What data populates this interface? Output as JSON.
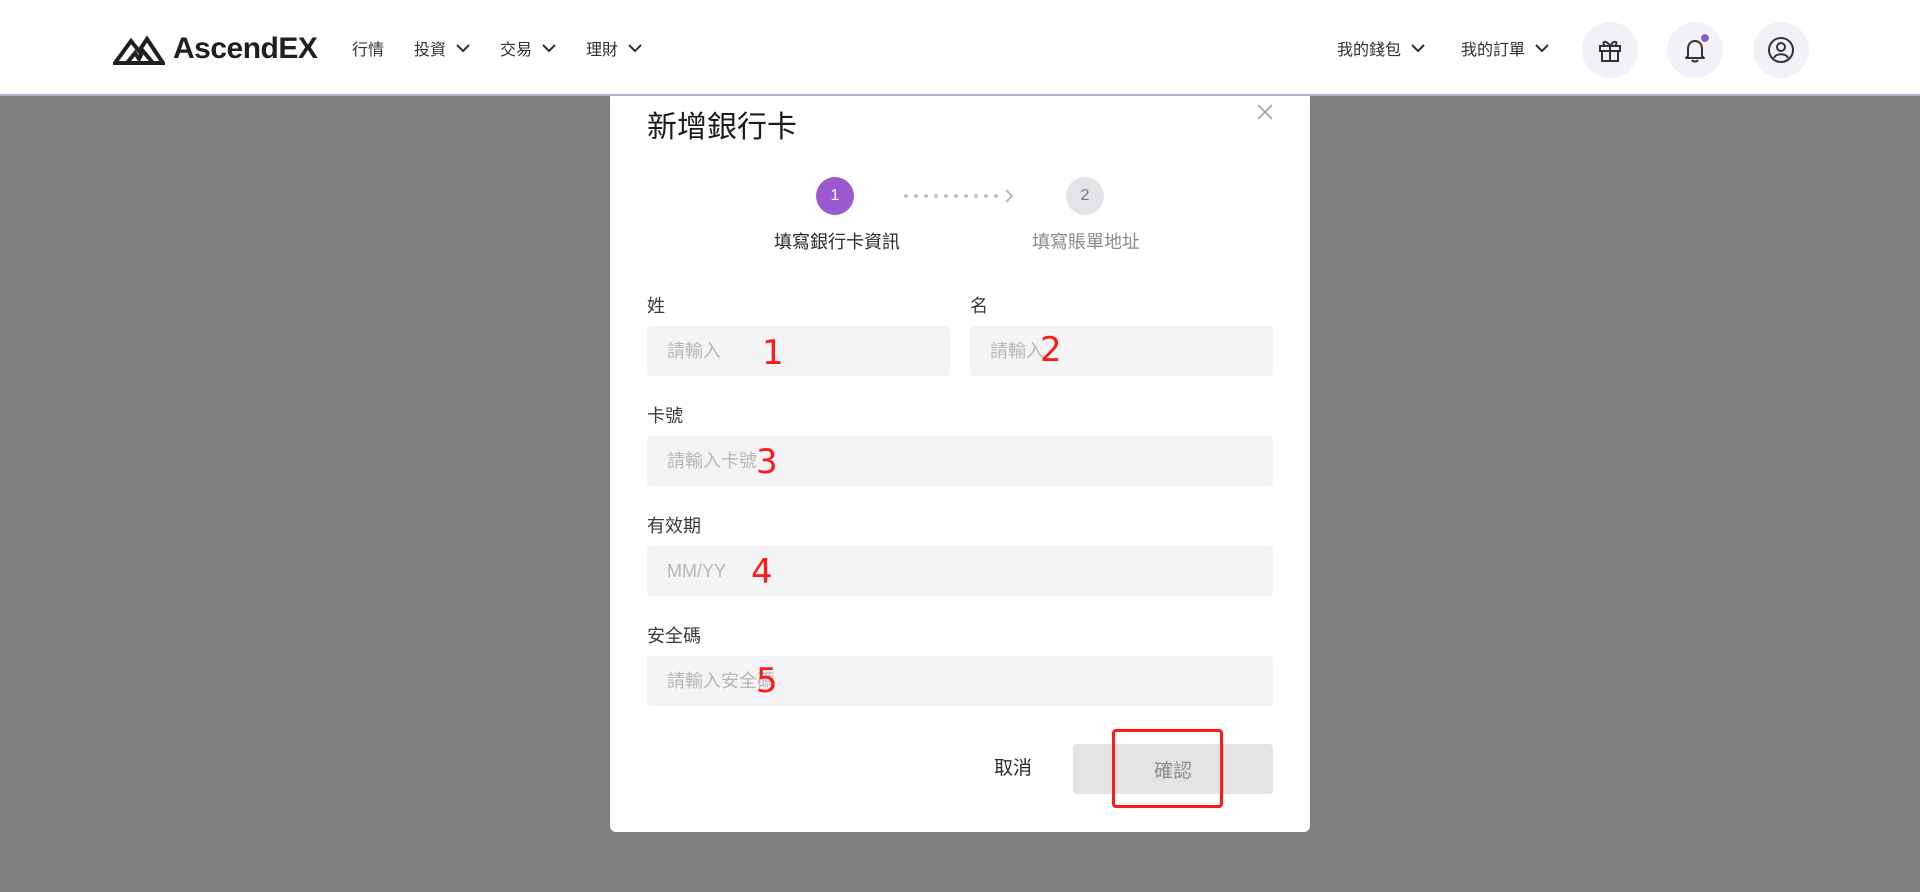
{
  "header": {
    "brand": "AscendEX",
    "nav": [
      {
        "label": "行情",
        "has_dropdown": false
      },
      {
        "label": "投資",
        "has_dropdown": true
      },
      {
        "label": "交易",
        "has_dropdown": true
      },
      {
        "label": "理財",
        "has_dropdown": true
      }
    ],
    "right_menu": [
      {
        "label": "我的錢包",
        "has_dropdown": true
      },
      {
        "label": "我的訂單",
        "has_dropdown": true
      }
    ],
    "icons": [
      "gift-icon",
      "bell-icon",
      "user-icon"
    ],
    "notification_dot_color": "#8b5fd0"
  },
  "modal": {
    "title": "新增銀行卡",
    "steps": [
      {
        "number": "1",
        "label": "填寫銀行卡資訊",
        "active": true
      },
      {
        "number": "2",
        "label": "填寫賬單地址",
        "active": false
      }
    ],
    "fields": {
      "last_name": {
        "label": "姓",
        "placeholder": "請輸入",
        "value": ""
      },
      "first_name": {
        "label": "名",
        "placeholder": "請輸入",
        "value": ""
      },
      "card_number": {
        "label": "卡號",
        "placeholder": "請輸入卡號",
        "value": ""
      },
      "expiry": {
        "label": "有效期",
        "placeholder": "MM/YY",
        "value": ""
      },
      "cvv": {
        "label": "安全碼",
        "placeholder": "請輸入安全碼",
        "value": ""
      }
    },
    "cancel_label": "取消",
    "confirm_label": "確認"
  },
  "annotations": [
    "1",
    "2",
    "3",
    "4",
    "5"
  ],
  "colors": {
    "accent": "#9b59d0",
    "overlay": "#808080",
    "annotation": "#ff1a1a"
  }
}
